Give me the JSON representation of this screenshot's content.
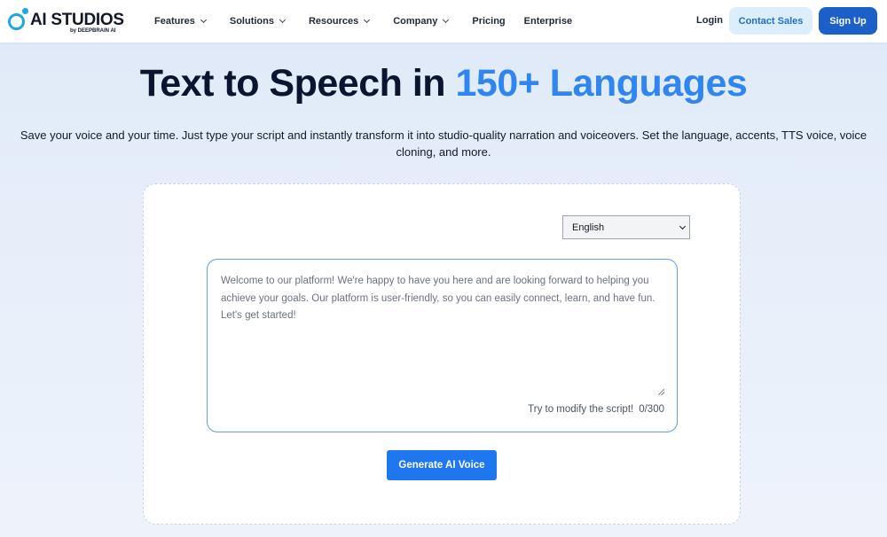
{
  "header": {
    "logo_text": "AI STUDIOS",
    "logo_sub": "by DEEPBRAIN AI",
    "nav": [
      {
        "label": "Features",
        "has_dropdown": true
      },
      {
        "label": "Solutions",
        "has_dropdown": true
      },
      {
        "label": "Resources",
        "has_dropdown": true
      },
      {
        "label": "Company",
        "has_dropdown": true
      },
      {
        "label": "Pricing",
        "has_dropdown": false
      },
      {
        "label": "Enterprise",
        "has_dropdown": false
      }
    ],
    "login_label": "Login",
    "contact_label": "Contact Sales",
    "signup_label": "Sign Up"
  },
  "hero": {
    "title_main": "Text to Speech in ",
    "title_accent": "150+ Languages",
    "subtitle": "Save your voice and your time. Just type your script and instantly transform it into studio-quality narration and voiceovers. Set the language, accents, TTS voice, voice cloning, and more."
  },
  "tts": {
    "language_selected": "English",
    "script_text": "Welcome to our platform! We're happy to have you here and are looking forward to helping you achieve your goals. Our platform is user-friendly, so you can easily connect, learn, and have fun. Let's get started!",
    "hint": "Try to modify the script!",
    "char_count": "0/300",
    "generate_label": "Generate AI Voice"
  },
  "colors": {
    "brand_blue": "#1b5fc9",
    "accent_blue": "#2f86f0",
    "button_blue": "#1f77f0",
    "contact_bg": "#dceefc"
  }
}
